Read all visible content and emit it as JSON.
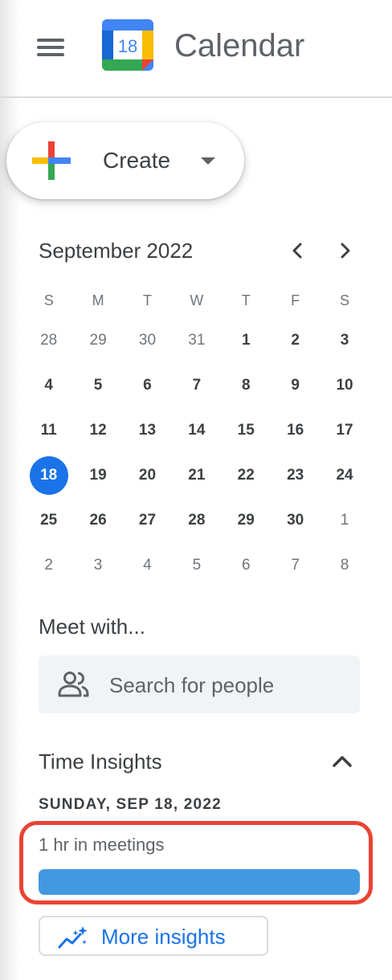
{
  "header": {
    "app_title": "Calendar",
    "logo_day": "18",
    "menu_icon": "hamburger-menu-icon"
  },
  "create": {
    "label": "Create",
    "icon": "google-plus-icon",
    "dropdown_icon": "caret-down-icon"
  },
  "mini_calendar": {
    "month_label": "September 2022",
    "prev_icon": "chevron-left-icon",
    "next_icon": "chevron-right-icon",
    "weekdays": [
      "S",
      "M",
      "T",
      "W",
      "T",
      "F",
      "S"
    ],
    "weeks": [
      [
        {
          "d": "28",
          "other": true
        },
        {
          "d": "29",
          "other": true
        },
        {
          "d": "30",
          "other": true
        },
        {
          "d": "31",
          "other": true
        },
        {
          "d": "1"
        },
        {
          "d": "2"
        },
        {
          "d": "3"
        }
      ],
      [
        {
          "d": "4"
        },
        {
          "d": "5"
        },
        {
          "d": "6"
        },
        {
          "d": "7"
        },
        {
          "d": "8"
        },
        {
          "d": "9"
        },
        {
          "d": "10"
        }
      ],
      [
        {
          "d": "11"
        },
        {
          "d": "12"
        },
        {
          "d": "13"
        },
        {
          "d": "14"
        },
        {
          "d": "15"
        },
        {
          "d": "16"
        },
        {
          "d": "17"
        }
      ],
      [
        {
          "d": "18",
          "today": true
        },
        {
          "d": "19"
        },
        {
          "d": "20"
        },
        {
          "d": "21"
        },
        {
          "d": "22"
        },
        {
          "d": "23"
        },
        {
          "d": "24"
        }
      ],
      [
        {
          "d": "25"
        },
        {
          "d": "26"
        },
        {
          "d": "27"
        },
        {
          "d": "28"
        },
        {
          "d": "29"
        },
        {
          "d": "30"
        },
        {
          "d": "1",
          "other": true
        }
      ],
      [
        {
          "d": "2",
          "other": true
        },
        {
          "d": "3",
          "other": true
        },
        {
          "d": "4",
          "other": true
        },
        {
          "d": "5",
          "other": true
        },
        {
          "d": "6",
          "other": true
        },
        {
          "d": "7",
          "other": true
        },
        {
          "d": "8",
          "other": true
        }
      ]
    ],
    "today_color": "#1a73e8"
  },
  "meet_with": {
    "title": "Meet with...",
    "search_placeholder": "Search for people",
    "icon": "people-icon"
  },
  "time_insights": {
    "title": "Time Insights",
    "collapse_icon": "chevron-up-icon",
    "date_label": "SUNDAY, SEP 18, 2022",
    "meetings_text": "1 hr in meetings",
    "meetings_bar_fraction": 1.0,
    "bar_color": "#4299e1",
    "highlight_color": "#ea4335",
    "more_button": "More insights",
    "more_icon": "insights-sparkle-icon"
  }
}
